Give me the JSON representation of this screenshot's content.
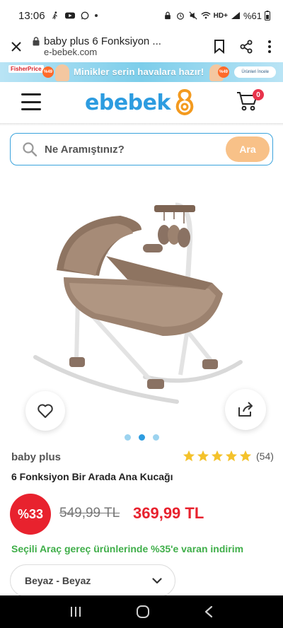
{
  "status_bar": {
    "time": "13:06",
    "battery": "%61",
    "network": "HD+"
  },
  "url_bar": {
    "page_title": "baby plus 6 Fonksiyon ...",
    "domain": "e-bebek.com"
  },
  "promo_banner": {
    "brand": "FisherPrice",
    "text": "Minikler serin havalara hazır!",
    "badge": "%49",
    "button": "Ürünleri İncele"
  },
  "header": {
    "logo_text": "ebebek",
    "cart_count": "0"
  },
  "search": {
    "placeholder": "Ne Aramıştınız?",
    "button_label": "Ara"
  },
  "gallery": {
    "dots": 3,
    "active_index": 1
  },
  "product": {
    "brand": "baby plus",
    "name": "6 Fonksiyon Bir Arada Ana Kucağı",
    "rating_stars": 5,
    "rating_count": "(54)",
    "discount_badge": "%33",
    "old_price": "549,99 TL",
    "new_price": "369,99 TL",
    "promo_text": "Seçili Araç gereç ürünlerinde %35'e varan indirim",
    "variant_label": "Beyaz - Beyaz"
  },
  "colors": {
    "brand_blue": "#2d9ce0",
    "sale_red": "#e8222e",
    "promo_green": "#3fae49",
    "star_yellow": "#f4c22b",
    "search_button": "#f8c188"
  }
}
